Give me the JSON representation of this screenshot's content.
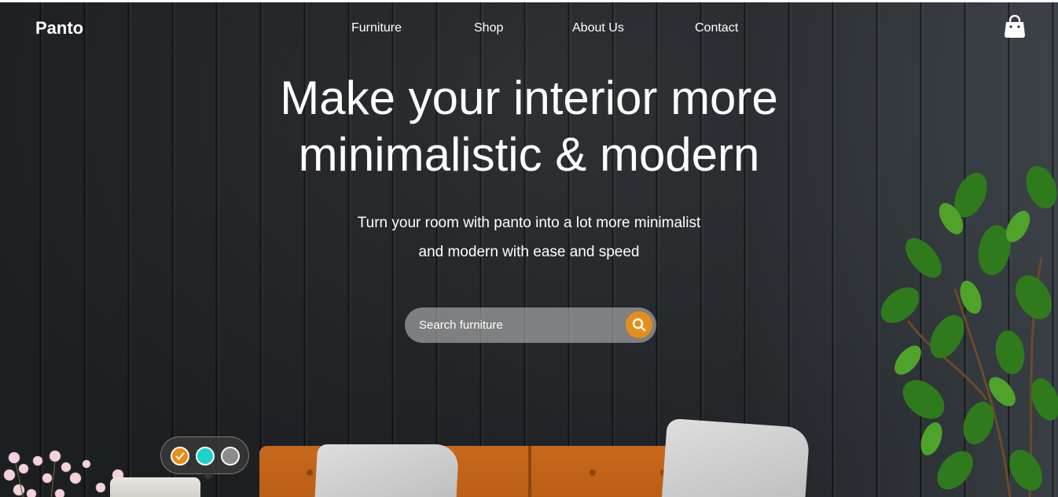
{
  "brand": "Panto",
  "nav": {
    "items": [
      {
        "label": "Furniture"
      },
      {
        "label": "Shop"
      },
      {
        "label": "About Us"
      },
      {
        "label": "Contact"
      }
    ],
    "cart_icon": "shopping-bag-icon"
  },
  "hero": {
    "title_line1": "Make your interior more",
    "title_line2": "minimalistic & modern",
    "subtitle_line1": "Turn your room with panto into a lot more minimalist",
    "subtitle_line2": "and modern with ease and speed"
  },
  "search": {
    "placeholder": "Search furniture",
    "icon": "search-icon",
    "accent_color": "#e58e1a"
  },
  "color_swatches": [
    {
      "color": "#e58e1a",
      "selected": true
    },
    {
      "color": "#1bd3c9",
      "selected": false
    },
    {
      "color": "#8c8c8c",
      "selected": false
    }
  ]
}
